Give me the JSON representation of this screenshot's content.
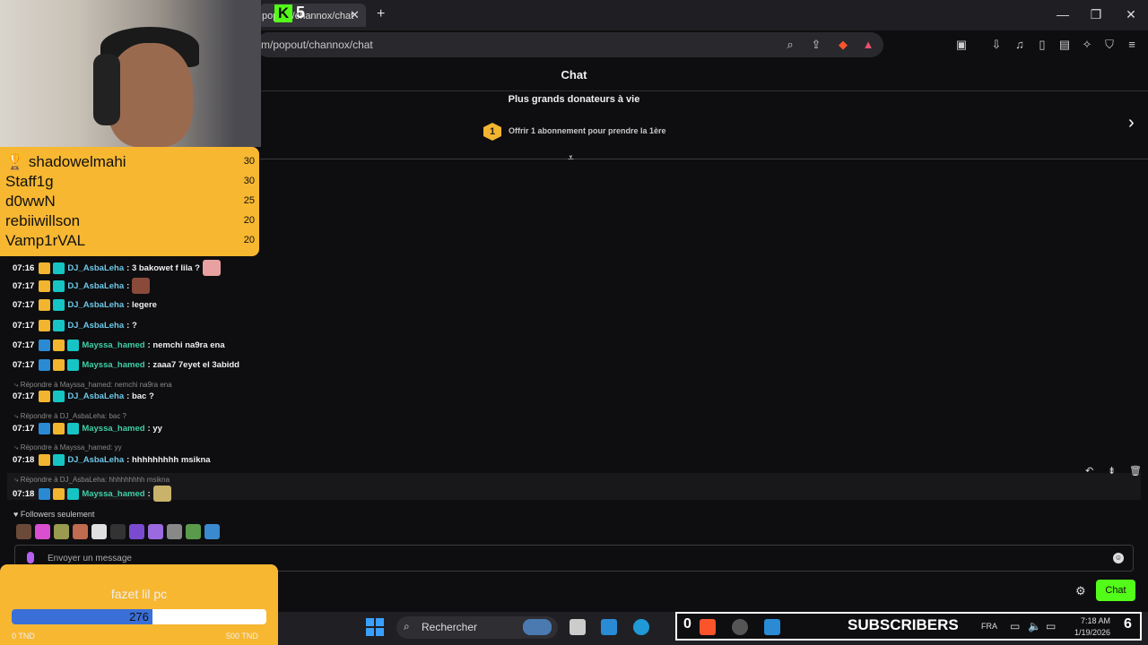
{
  "browser": {
    "tab_title": "popout/channox/chat",
    "tab_logo": "K",
    "tab_badge": "5",
    "url": "m/popout/channox/chat",
    "new_tab": "+",
    "tab_close": "✕",
    "window": {
      "minimize": "—",
      "maximize": "❐",
      "close": "✕"
    }
  },
  "chat": {
    "title": "Chat",
    "donors_title": "Plus grands donateurs à vie",
    "donor_rank": "1",
    "donor_subtitle": "Offrir 1 abonnement pour prendre la 1ère"
  },
  "leaderboard": [
    {
      "name": "🏆 shadowelmahi",
      "score": "30"
    },
    {
      "name": "Staff1g",
      "score": "30"
    },
    {
      "name": "d0wwN",
      "score": "25"
    },
    {
      "name": "rebiiwillson",
      "score": "20"
    },
    {
      "name": "Vamp1rVAL",
      "score": "20"
    }
  ],
  "messages": [
    {
      "time": "07:16",
      "user": "DJ_AsbaLeha",
      "text": ": 3 bakowet f lila ?"
    },
    {
      "time": "07:17",
      "user": "DJ_AsbaLeha",
      "text": ":"
    },
    {
      "time": "07:17",
      "user": "DJ_AsbaLeha",
      "text": ": legere"
    },
    {
      "time": "07:17",
      "user": "DJ_AsbaLeha",
      "text": ": ?"
    },
    {
      "time": "07:17",
      "user": "Mayssa_hamed",
      "text": ": nemchi na9ra ena"
    },
    {
      "time": "07:17",
      "user": "Mayssa_hamed",
      "text": ": zaaa7 7eyet el 3abidd"
    },
    {
      "reply": "Répondre à Mayssa_hamed: nemchi na9ra ena",
      "time": "07:17",
      "user": "DJ_AsbaLeha",
      "text": ": bac ?"
    },
    {
      "reply": "Répondre à DJ_AsbaLeha: bac ?",
      "time": "07:17",
      "user": "Mayssa_hamed",
      "text": ": yy"
    },
    {
      "reply": "Répondre à Mayssa_hamed: yy",
      "time": "07:18",
      "user": "DJ_AsbaLeha",
      "text": ": hhhhhhhhh msikna"
    },
    {
      "reply": "Répondre à DJ_AsbaLeha: hhhhhhhhh msikna",
      "time": "07:18",
      "user": "Mayssa_hamed",
      "text": ":"
    }
  ],
  "followers_only": "♥ Followers seulement",
  "input": {
    "placeholder": "Envoyer un message"
  },
  "chat_button": "Chat",
  "goal": {
    "title": "fazet lil pc",
    "current": "276",
    "min": "0 TND",
    "max": "500 TND",
    "progress": 0.552
  },
  "taskbar": {
    "search_label": "Rechercher",
    "subs_count": "0",
    "subs_label": "SUBSCRIBERS",
    "lang": "FRA",
    "time": "7:18 AM",
    "date": "1/19/2026",
    "subs_right": "6"
  },
  "colors": {
    "kick_green": "#53fc18",
    "overlay_yellow": "#f7b731",
    "goal_blue": "#3a6fd8"
  }
}
